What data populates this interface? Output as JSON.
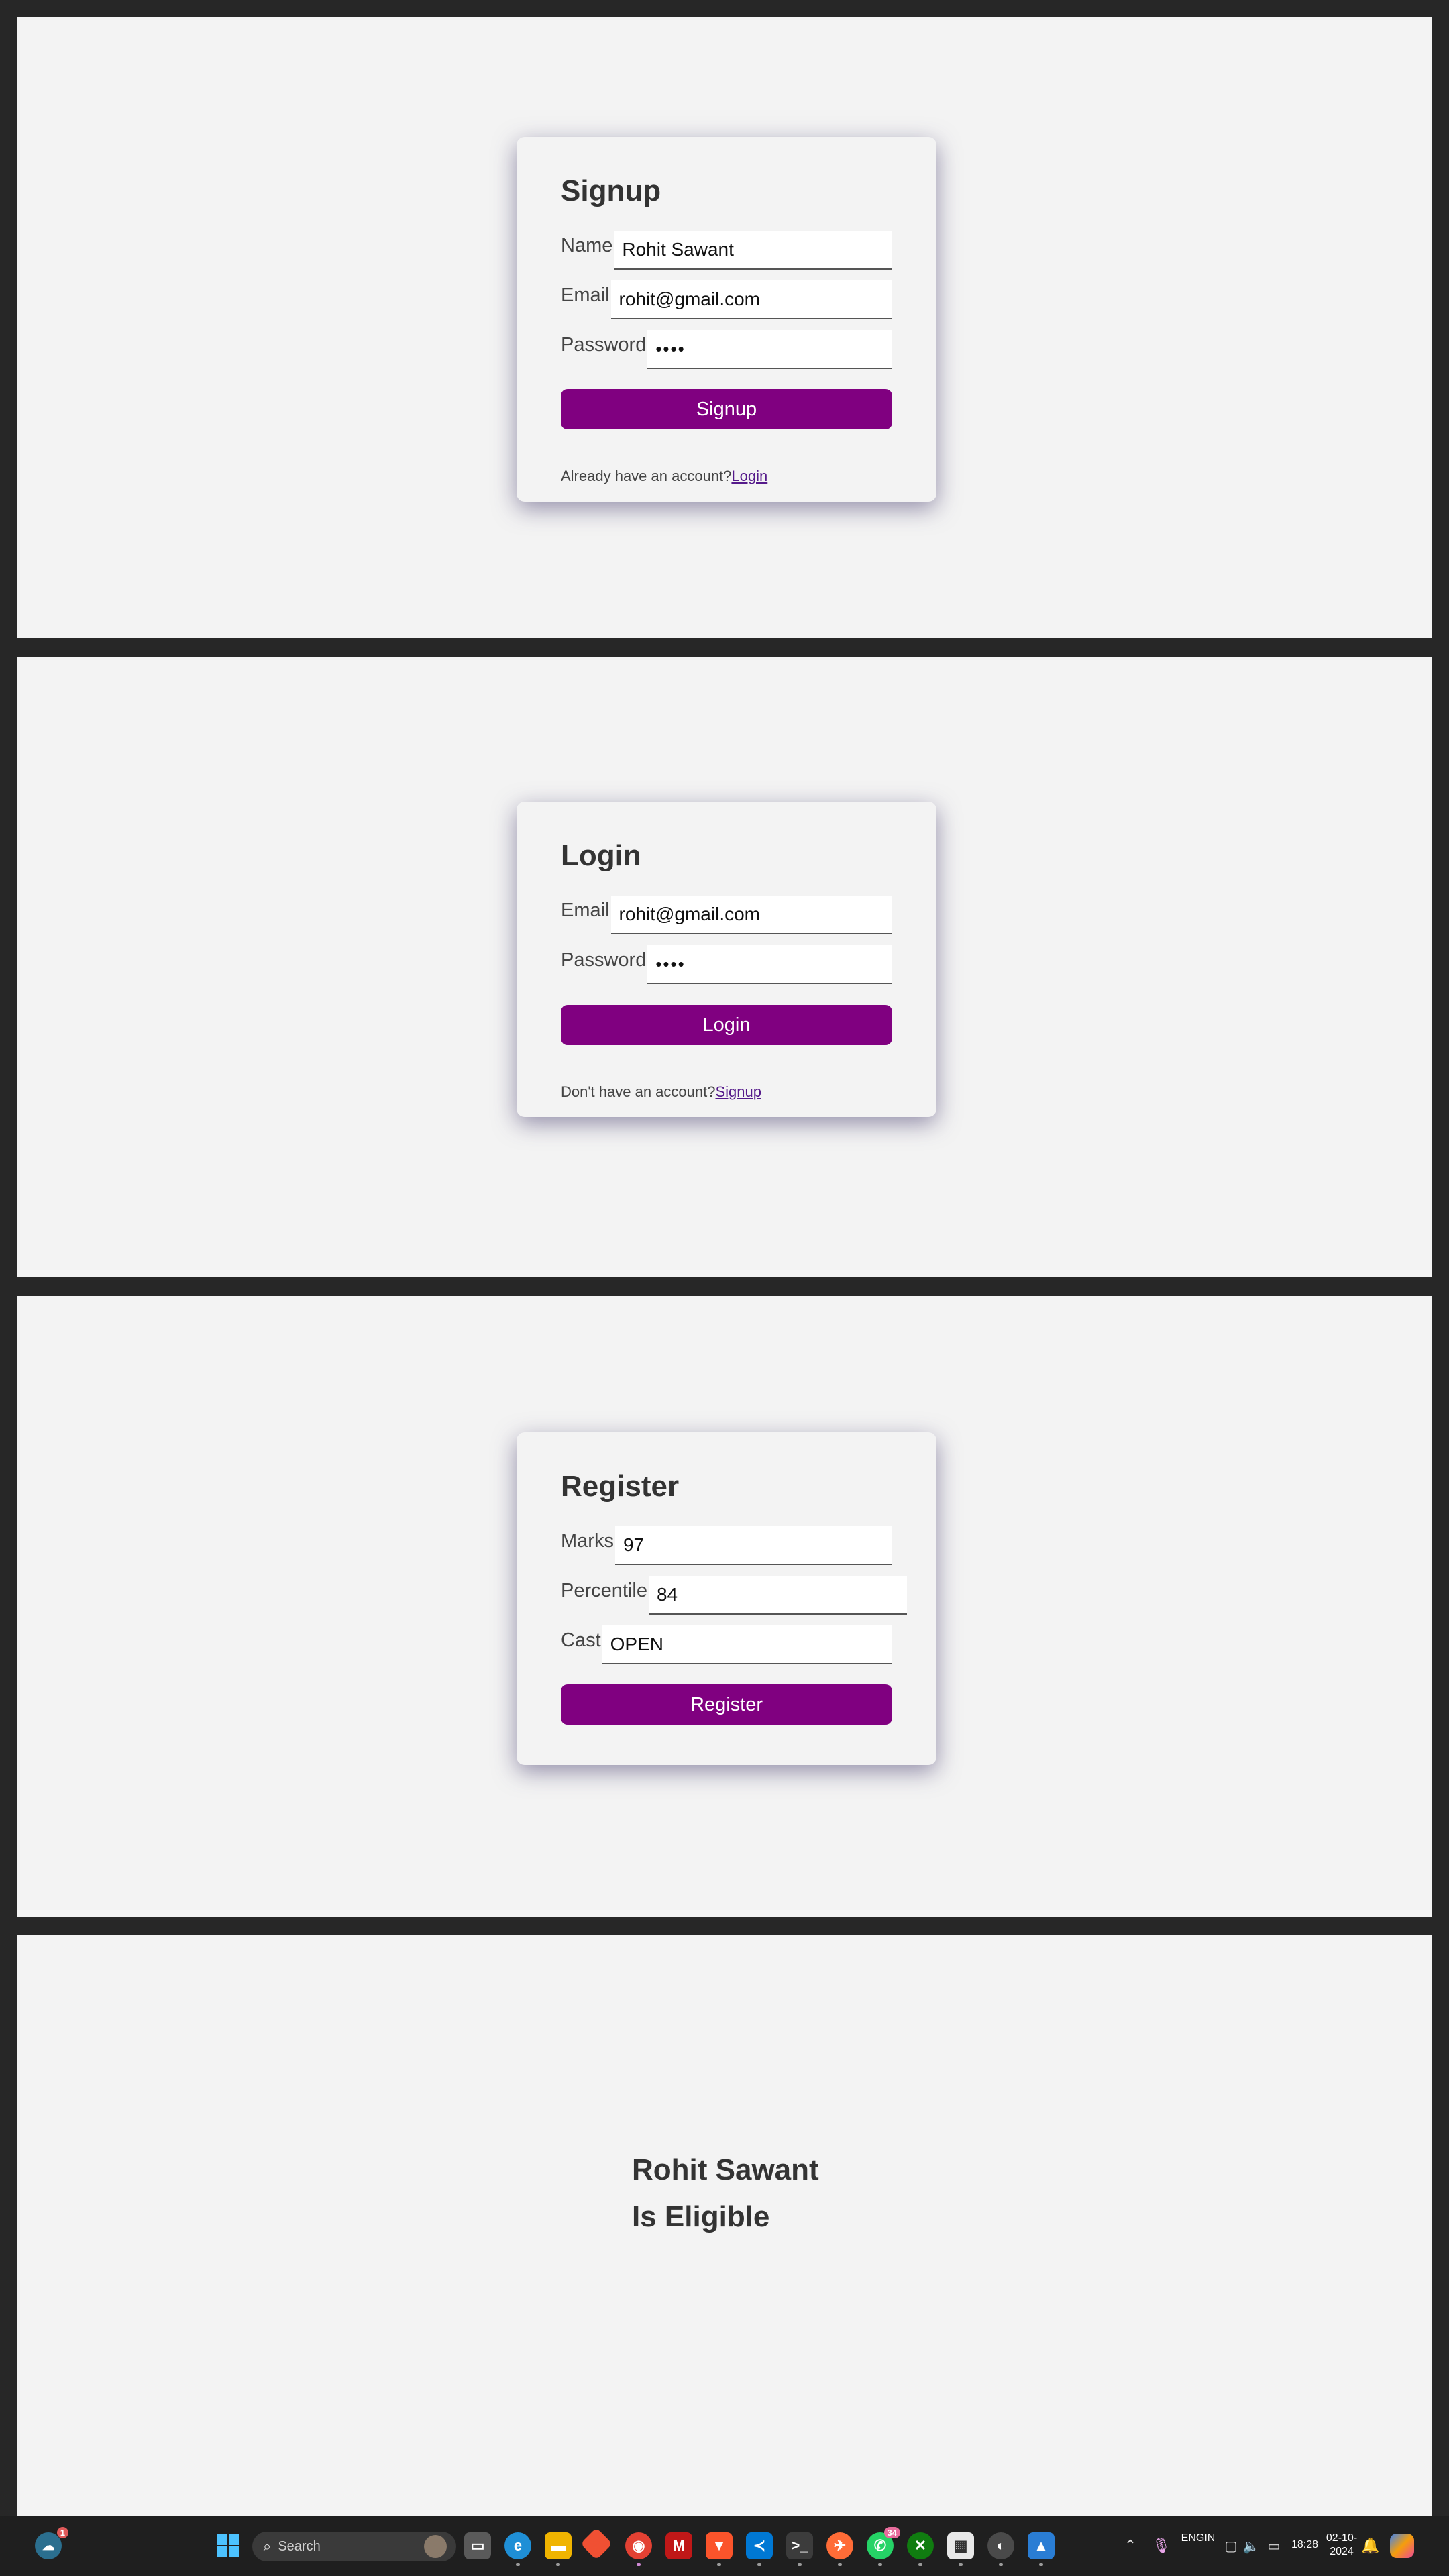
{
  "signup": {
    "title": "Signup",
    "name_label": "Name",
    "name_value": "Rohit Sawant",
    "email_label": "Email",
    "email_value": "rohit@gmail.com",
    "password_label": "Password",
    "password_value": "••••",
    "button_label": "Signup",
    "footer_text": "Already have an account?",
    "footer_link": "Login"
  },
  "login": {
    "title": "Login",
    "email_label": "Email",
    "email_value": "rohit@gmail.com",
    "password_label": "Password",
    "password_value": "••••",
    "button_label": "Login",
    "footer_text": "Don't have an account?",
    "footer_link": "Signup"
  },
  "register": {
    "title": "Register",
    "marks_label": "Marks",
    "marks_value": "97",
    "percentile_label": "Percentile",
    "percentile_value": "84",
    "cast_label": "Cast",
    "cast_value": "OPEN",
    "button_label": "Register"
  },
  "result": {
    "name": "Rohit Sawant",
    "status": "Is Eligible"
  },
  "taskbar": {
    "search_label": "Search",
    "widgets_badge": "1",
    "whatsapp_badge": "34",
    "language_line1": "ENG",
    "language_line2": "IN",
    "time": "18:28",
    "date": "02-10-2024",
    "apps": [
      "start-icon",
      "task-view-icon",
      "edge-icon",
      "file-explorer-icon",
      "git-icon",
      "chrome-icon",
      "mcafee-icon",
      "brave-icon",
      "vscode-icon",
      "terminal-icon",
      "postman-icon",
      "whatsapp-icon",
      "xbox-icon",
      "store-icon",
      "ubuntu-icon",
      "photos-icon"
    ]
  },
  "colors": {
    "accent": "#800080",
    "panel_bg": "#f3f3f3",
    "frame_bg": "#272727",
    "taskbar_bg": "#1f1f1f"
  }
}
